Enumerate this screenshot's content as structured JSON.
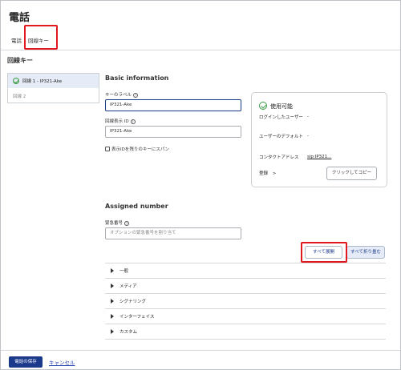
{
  "page": {
    "title": "電話"
  },
  "tabs": [
    {
      "label": "電話"
    },
    {
      "label": "回線キー"
    }
  ],
  "section": {
    "title": "回線キー"
  },
  "line_list": [
    {
      "label": "回線 1 - IP321-Ake",
      "status": "active"
    },
    {
      "label": "回線 2"
    }
  ],
  "basic_info": {
    "heading": "Basic information",
    "key_label": {
      "label": "キーのラベル",
      "value": "IP321-Ake"
    },
    "line_display_id": {
      "label": "回線表示 ID",
      "value": "IP321-Ake"
    },
    "span_checkbox": {
      "label": "表示IDを残りのキーにスパン",
      "checked": false
    }
  },
  "status_card": {
    "status": "使用可能",
    "login_user_label": "ログインしたユーザー",
    "login_user_value": "-",
    "default_user_label": "ユーザーのデフォルト",
    "default_user_value": "-",
    "contact_label": "コンタクトアドレス",
    "contact_value": "sip:IP321...",
    "register_label": "登録",
    "register_chevron": ">",
    "copy_button": "クリックしてコピー"
  },
  "assigned": {
    "heading": "Assigned number",
    "emergency_label": "緊急番号",
    "emergency_placeholder": "オプションの緊急番号を割り当て"
  },
  "actions": {
    "expand_all": "すべて展開",
    "collapse_all": "すべて折り畳む"
  },
  "accordion": [
    {
      "label": "一般"
    },
    {
      "label": "メディア"
    },
    {
      "label": "シグナリング"
    },
    {
      "label": "インターフェイス"
    },
    {
      "label": "カスタム"
    }
  ],
  "footer": {
    "save": "電話の保存",
    "cancel": "キャンセル"
  },
  "colors": {
    "primary": "#1b3a8c",
    "highlight": "#e0191f",
    "success": "#3a9a44",
    "link": "#2a4bb5"
  }
}
